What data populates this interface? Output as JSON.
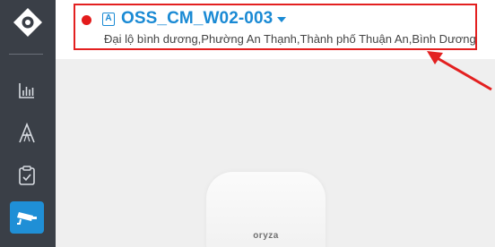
{
  "sidebar": {
    "logo_icon": "eye-logo-icon",
    "items": [
      {
        "name": "reports",
        "icon": "bar-chart-icon",
        "active": false
      },
      {
        "name": "analytics",
        "icon": "letter-a-icon",
        "active": false
      },
      {
        "name": "tasks",
        "icon": "clipboard-check-icon",
        "active": false
      },
      {
        "name": "cameras",
        "icon": "camera-icon",
        "active": true
      }
    ]
  },
  "header": {
    "status": "offline",
    "status_color": "#e31b1b",
    "camera_badge": "A",
    "camera_name": "OSS_CM_W02-003",
    "address": "Đại lộ bình dương,Phường An Thạnh,Thành phố Thuận An,Bình Dương"
  },
  "preview": {
    "device_brand": "oryza"
  },
  "colors": {
    "accent": "#1a8ad4",
    "sidebar_bg": "#3a3f47",
    "highlight": "#e32020"
  }
}
